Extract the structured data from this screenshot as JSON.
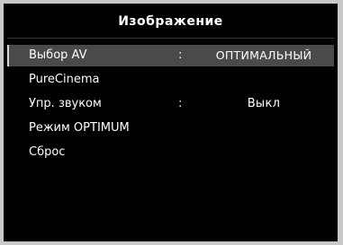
{
  "menu": {
    "title": "Изображение",
    "items": [
      {
        "label": "Выбор AV",
        "separator": ":",
        "value": "ОПТИМАЛЬНЫЙ",
        "selected": true
      },
      {
        "label": "PureCinema"
      },
      {
        "label": "Упр. звуком",
        "separator": ":",
        "value": "Выкл"
      },
      {
        "label": "Режим OPTIMUM"
      },
      {
        "label": "Сброс"
      }
    ]
  },
  "colors": {
    "background": "#000000",
    "frame": "#c9c9c9",
    "selected_row": "#4a4a4a",
    "text": "#ffffff"
  }
}
